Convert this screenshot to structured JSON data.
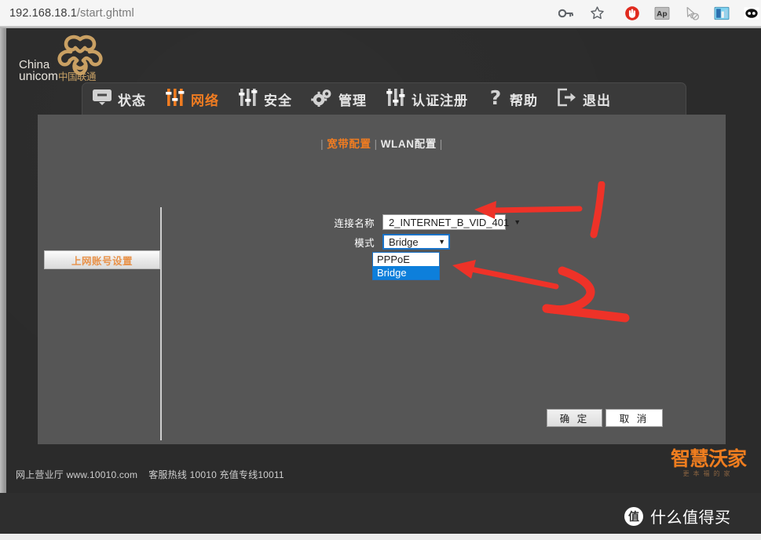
{
  "browser": {
    "url_host": "192.168.18.1",
    "url_path": "/start.ghtml",
    "omnibox_icons": [
      {
        "name": "password-key-icon",
        "glyph": "key"
      },
      {
        "name": "bookmark-star-icon",
        "glyph": "star"
      }
    ],
    "extension_icons": [
      {
        "name": "adblock-icon",
        "glyph": "circle-hand"
      },
      {
        "name": "ap-extension-icon",
        "glyph": "Ap"
      },
      {
        "name": "cursor-block-icon",
        "glyph": "cursor-slash"
      },
      {
        "name": "image-extension-icon",
        "glyph": "picture"
      },
      {
        "name": "eyes-extension-icon",
        "glyph": "eyes"
      },
      {
        "name": "partial-extension-icon",
        "glyph": "partial"
      }
    ]
  },
  "brand": {
    "logo_line1": "China",
    "logo_line2": "unicom",
    "logo_cn": "中国联通",
    "knot_color": "#c9a063"
  },
  "nav": {
    "items": [
      {
        "label": "状态",
        "icon": "monitor-icon",
        "active": false
      },
      {
        "label": "网络",
        "icon": "sliders-icon",
        "active": true
      },
      {
        "label": "安全",
        "icon": "sliders-icon",
        "active": false
      },
      {
        "label": "管理",
        "icon": "gears-icon",
        "active": false
      },
      {
        "label": "认证注册",
        "icon": "sliders-icon",
        "active": false
      },
      {
        "label": "帮助",
        "icon": "question-icon",
        "active": false
      },
      {
        "label": "退出",
        "icon": "logout-icon",
        "active": false
      }
    ],
    "active_color": "#f07c21"
  },
  "tabs": {
    "leading_sep": "|",
    "items": [
      {
        "label": "宽带配置",
        "active": true
      },
      {
        "label": "WLAN配置",
        "active": false
      }
    ],
    "separator": "|",
    "trailing_sep": "|"
  },
  "sidebar": {
    "items": [
      {
        "label": "上网账号设置",
        "active": true
      }
    ]
  },
  "form": {
    "fields": [
      {
        "label": "连接名称",
        "value": "2_INTERNET_B_VID_401",
        "caret": "▼"
      },
      {
        "label": "模式",
        "value": "Bridge",
        "caret": "▼"
      }
    ],
    "mode_dropdown": {
      "open": true,
      "options": [
        {
          "label": "PPPoE",
          "selected": false
        },
        {
          "label": "Bridge",
          "selected": true
        }
      ],
      "highlight_color": "#0d7fdb"
    }
  },
  "actions": {
    "confirm_label": "确 定",
    "cancel_label": "取 消"
  },
  "footer": {
    "hall_label": "网上营业厅",
    "website": "www.10010.com",
    "hotline_label": "客服热线",
    "hotline_number": "10010",
    "recharge_label": "充值专线",
    "recharge_number": "10011",
    "brand_main": "智慧沃家",
    "brand_sub": "更本福的家",
    "brand_color": "#ef7d1f"
  },
  "watermark": {
    "badge": "值",
    "text": "什么值得买"
  },
  "annotations": [
    {
      "name": "arrow-to-connection-name",
      "number": "1"
    },
    {
      "name": "arrow-to-bridge-option",
      "number": "2"
    }
  ]
}
